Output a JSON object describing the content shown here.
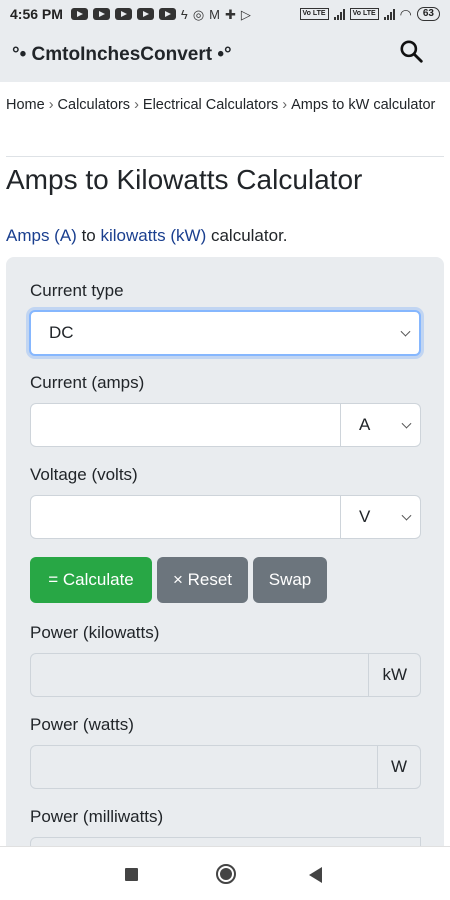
{
  "status_bar": {
    "time": "4:56 PM",
    "battery": "63",
    "volte1": "Vo LTE",
    "volte2": "Vo LTE"
  },
  "header": {
    "brand": "°• CmtoInchesConvert •°"
  },
  "breadcrumb": {
    "items": [
      "Home",
      "Calculators",
      "Electrical Calculators",
      "Amps to kW calculator"
    ],
    "separator": "›"
  },
  "page": {
    "title": "Amps to Kilowatts Calculator",
    "intro_link1": "Amps (A)",
    "intro_mid": " to ",
    "intro_link2": "kilowatts (kW)",
    "intro_end": " calculator."
  },
  "form": {
    "current_type_label": "Current type",
    "current_type_value": "DC",
    "current_label": "Current (amps)",
    "current_value": "",
    "current_unit": "A",
    "voltage_label": "Voltage (volts)",
    "voltage_value": "",
    "voltage_unit": "V",
    "calculate_label": "= Calculate",
    "reset_label": "× Reset",
    "swap_label": "Swap",
    "power_kw_label": "Power (kilowatts)",
    "power_kw_unit": "kW",
    "power_w_label": "Power (watts)",
    "power_w_unit": "W",
    "power_mw_label": "Power (milliwatts)"
  },
  "colors": {
    "calculate": "#28a745",
    "secondary": "#6c757d",
    "link": "#1a3f8f",
    "header_bg": "#e9ecef"
  }
}
